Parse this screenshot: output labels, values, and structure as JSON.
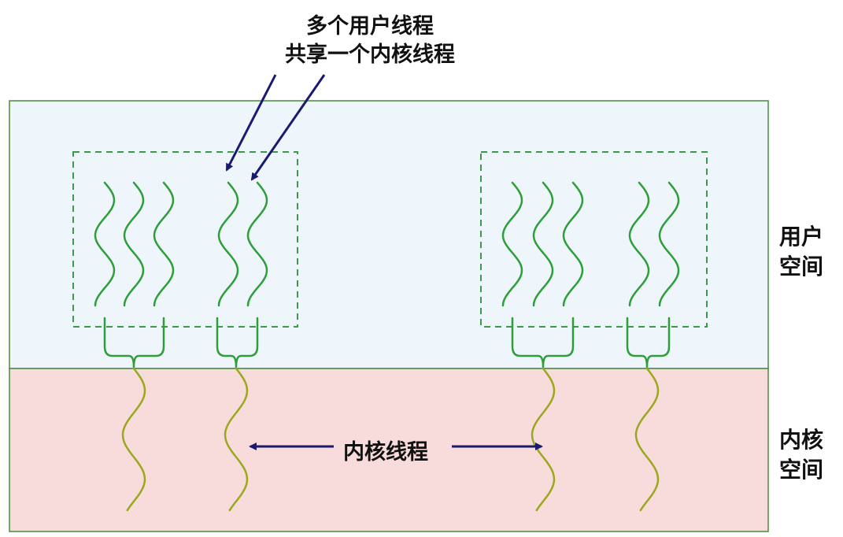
{
  "annotation": {
    "line1": "多个用户线程",
    "line2": "共享一个内核线程"
  },
  "user_space_label": {
    "line1": "用户",
    "line2": "空间"
  },
  "kernel_space_label": {
    "line1": "内核",
    "line2": "空间"
  },
  "kernel_thread_label": "内核线程",
  "colors": {
    "user_space_fill": "#eef5fb",
    "kernel_space_fill": "#f8dcdc",
    "border": "#4a8a3a",
    "user_thread": "#2e9e3a",
    "kernel_thread": "#9aa81e",
    "arrow": "#1a1a6e"
  }
}
